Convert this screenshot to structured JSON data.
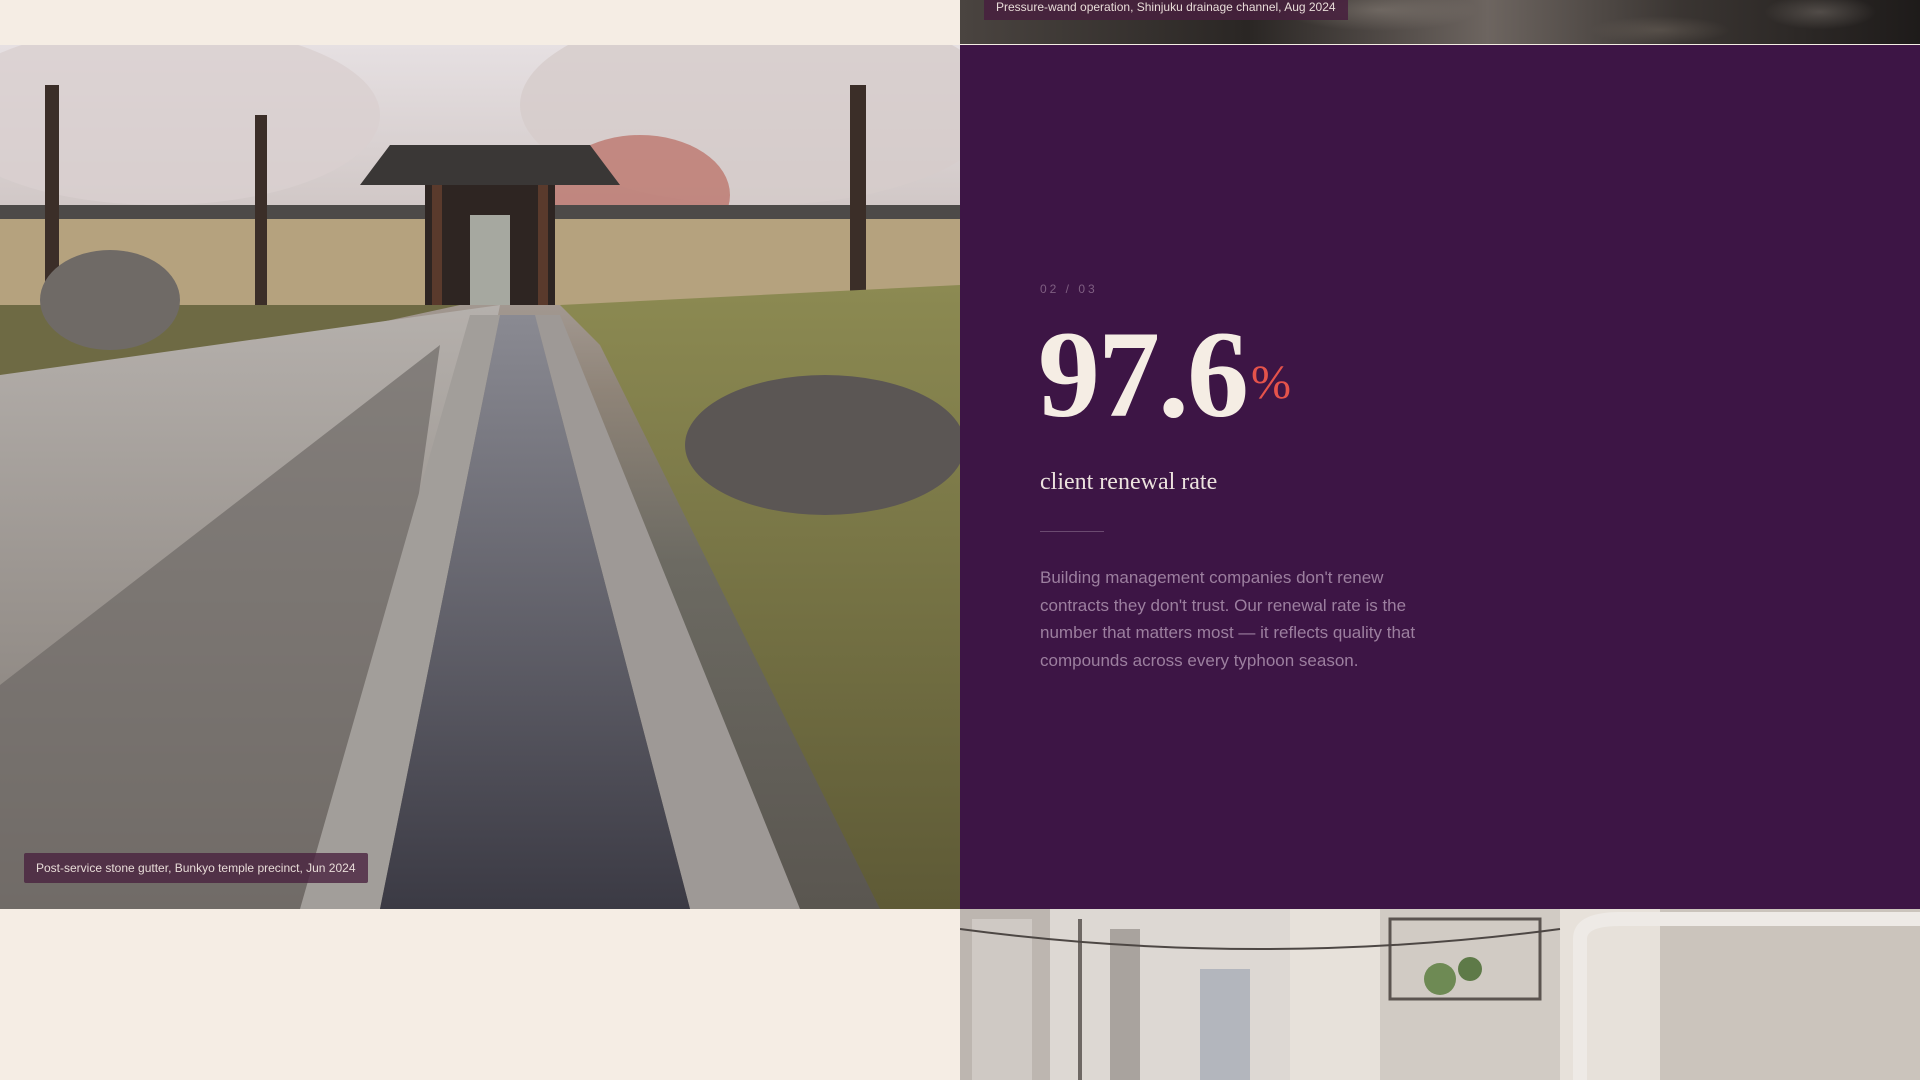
{
  "photos": {
    "top": {
      "caption": "Pressure-wand operation, Shinjuku drainage channel, Aug 2024"
    },
    "left": {
      "caption": "Post-service stone gutter, Bunkyo temple precinct, Jun 2024"
    }
  },
  "stat": {
    "index": "02 / 03",
    "value": "97.6",
    "unit": "%",
    "label": "client renewal rate",
    "description": "Building management companies don't renew contracts they don't trust. Our renewal rate is the number that matters most — it reflects quality that compounds across every typhoon season."
  },
  "colors": {
    "panel_background": "#3d1545",
    "page_background": "#f5ede4",
    "accent": "#e5534b",
    "stat_text": "#f5ede4"
  }
}
